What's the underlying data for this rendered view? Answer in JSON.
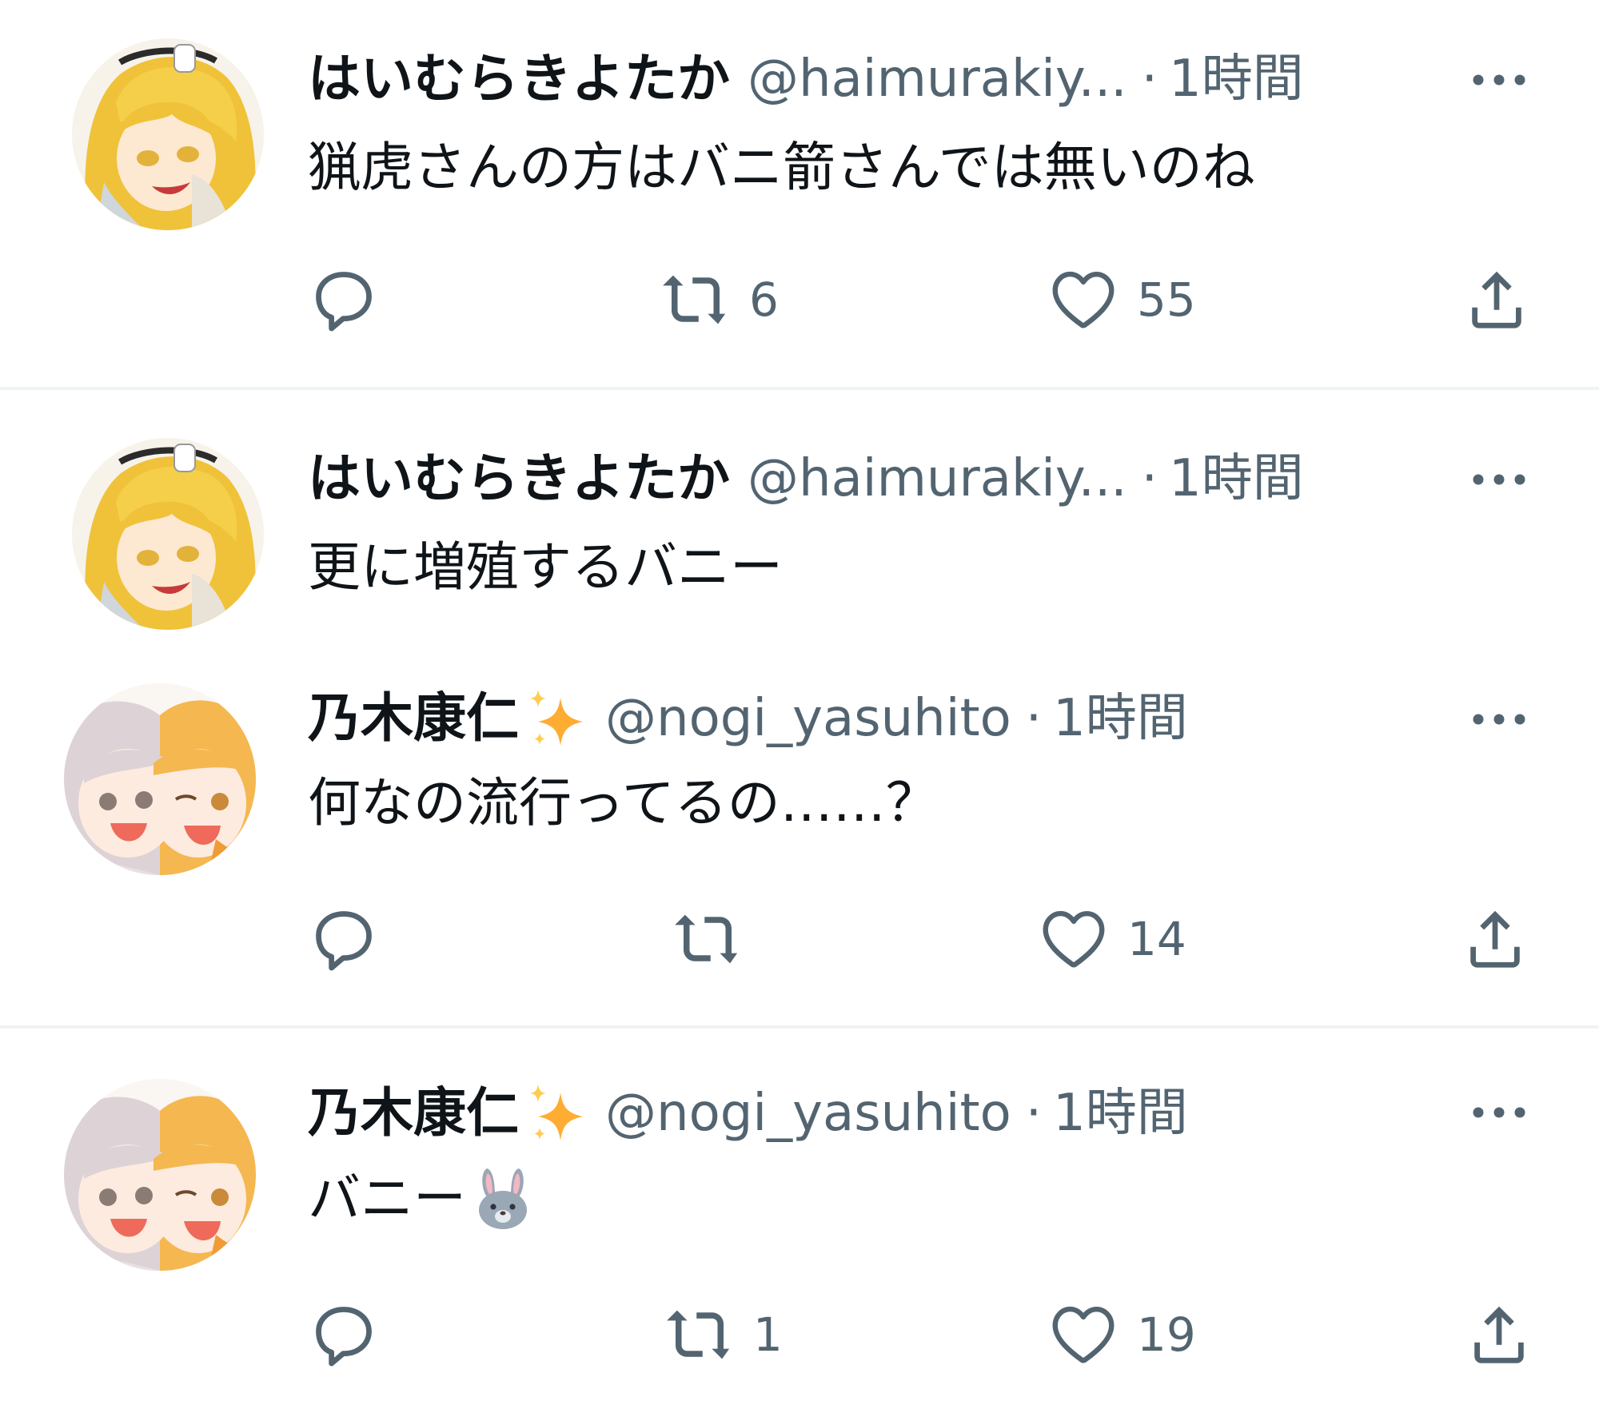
{
  "colors": {
    "text_primary": "#0f1419",
    "text_secondary": "#536471",
    "divider": "#eff3f4",
    "sparkle": "#ffac33"
  },
  "tweets": [
    {
      "display_name": "はいむらきよたか",
      "handle": "@haimurakiy...",
      "separator": "·",
      "time": "1時間",
      "text": "猟虎さんの方はバニ箭さんでは無いのね",
      "avatar_icon": "blonde-girl-avatar",
      "replies": "",
      "retweets": "6",
      "likes": "55"
    },
    {
      "display_name": "はいむらきよたか",
      "handle": "@haimurakiy...",
      "separator": "·",
      "time": "1時間",
      "text": "更に増殖するバニー",
      "avatar_icon": "blonde-girl-avatar",
      "has_actions": false
    },
    {
      "display_name": "乃木康仁",
      "display_name_icon": "sparkles-emoji",
      "handle": "@nogi_yasuhito",
      "separator": "·",
      "time": "1時間",
      "text": "何なの流行ってるの……？",
      "avatar_icon": "two-girls-avatar",
      "replies": "",
      "retweets": "",
      "likes": "14"
    },
    {
      "display_name": "乃木康仁",
      "display_name_icon": "sparkles-emoji",
      "handle": "@nogi_yasuhito",
      "separator": "·",
      "time": "1時間",
      "text": "バニー",
      "text_icon": "rabbit-face-emoji",
      "avatar_icon": "two-girls-avatar",
      "replies": "",
      "retweets": "1",
      "likes": "19"
    }
  ]
}
